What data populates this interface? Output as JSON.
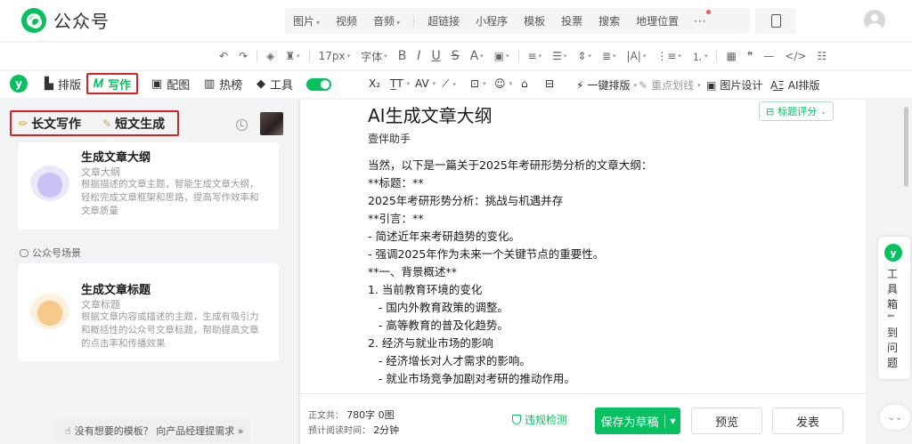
{
  "app": {
    "name": "公众号"
  },
  "insert_bar": {
    "items": [
      {
        "label": "图片",
        "dropdown": true
      },
      {
        "label": "视频",
        "dropdown": false
      },
      {
        "label": "音频",
        "dropdown": true
      },
      {
        "label": "超链接",
        "dropdown": false
      },
      {
        "label": "小程序",
        "dropdown": false
      },
      {
        "label": "模板",
        "dropdown": false
      },
      {
        "label": "投票",
        "dropdown": false
      },
      {
        "label": "搜索",
        "dropdown": false
      },
      {
        "label": "地理位置",
        "dropdown": false
      }
    ],
    "more": "···"
  },
  "format_toolbar": {
    "font_size": "17px",
    "font_family": "字体",
    "bold": "B",
    "italic": "I",
    "underline": "U",
    "strike": "S",
    "font_color": "A"
  },
  "plugin_toolbar": {
    "tabs": [
      {
        "label": "排版"
      },
      {
        "label": "写作"
      },
      {
        "label": "配图"
      },
      {
        "label": "热榜"
      },
      {
        "label": "工具"
      }
    ],
    "right_items": [
      {
        "label": "一键排版"
      },
      {
        "label": "重点划线"
      },
      {
        "label": "图片设计"
      },
      {
        "label": "AI排版"
      }
    ]
  },
  "left_panel": {
    "tabs": [
      "长文写作",
      "短文生成"
    ],
    "cards": [
      {
        "title": "生成文章大纲",
        "subtitle": "文章大纲",
        "description": "根据描述的文章主题，智能生成文章大纲，轻松完成文章框架和思路，提高写作效率和文章质量"
      },
      {
        "title": "生成文章标题",
        "subtitle": "文章标题",
        "description": "根据文章内容或描述的主题，生成有吸引力和概括性的公众号文章标题，帮助提高文章的点击率和传播效果"
      }
    ],
    "scene_label": "公众号场景",
    "feedback": "没有想要的模板？ 向产品经理提需求 »"
  },
  "editor": {
    "title": "AI生成文章大纲",
    "author": "壹伴助手",
    "title_score": "标题评分",
    "lines": [
      "当然，以下是一篇关于2025年考研形势分析的文章大纲：",
      "**标题：**",
      "2025年考研形势分析：挑战与机遇并存",
      "**引言：**",
      "- 简述近年来考研趋势的变化。",
      "- 强调2025年作为未来一个关键节点的重要性。",
      "**一、背景概述**",
      "1. 当前教育环境的变化",
      "   - 国内外教育政策的调整。",
      "   - 高等教育的普及化趋势。",
      "2. 经济与就业市场的影响",
      "   - 经济增长对人才需求的影响。",
      "   - 就业市场竞争加剧对考研的推动作用。"
    ]
  },
  "bottombar": {
    "word_count_label": "正文共：",
    "word_count": "780字 0图",
    "read_time_label": "预计阅读时间：",
    "read_time": "2分钟",
    "violation": "违规检测",
    "save": "保存为草稿",
    "preview": "预览",
    "publish": "发表"
  },
  "right_rail": {
    "toolbox_label": "工具箱",
    "jump_label": "到问题"
  },
  "colors": {
    "brand_green": "#07c160",
    "highlight_red": "#e02020"
  }
}
